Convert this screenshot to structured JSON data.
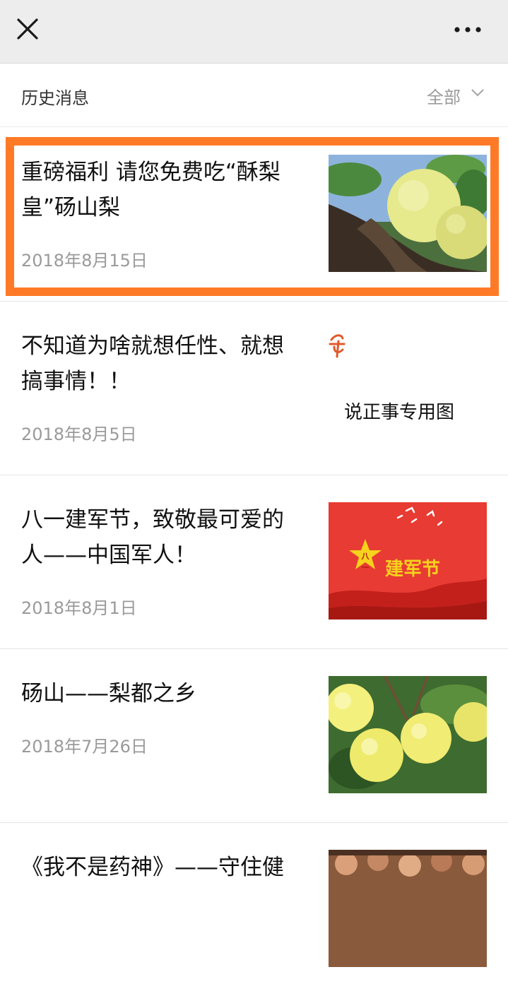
{
  "header": {
    "close_icon": "close-icon",
    "more_icon": "more-icon"
  },
  "subheader": {
    "title": "历史消息",
    "filter_label": "全部",
    "filter_icon": "chevron-down-icon"
  },
  "colors": {
    "highlight": "#ff7a26",
    "date_text": "#9a9a9a",
    "title_text": "#111111"
  },
  "articles": [
    {
      "title": "重磅福利 请您免费吃“酥梨皇”砀山梨",
      "date": "2018年8月15日",
      "thumbnail": "pear-on-tree-image",
      "selected": true
    },
    {
      "title": "不知道为啥就想任性、就想搞事情！！",
      "date": "2018年8月5日",
      "thumbnail_caption": "说正事专用图",
      "thumbnail": "text-graphic-image"
    },
    {
      "title": "八一建军节，致敬最可爱的人——中国军人！",
      "date": "2018年8月1日",
      "thumbnail_text": "建军节",
      "thumbnail_badge": "八一",
      "thumbnail": "army-day-poster-image"
    },
    {
      "title": "砀山——梨都之乡",
      "date": "2018年7月26日",
      "thumbnail": "pears-cluster-image"
    },
    {
      "title": "《我不是药神》——守住健",
      "thumbnail": "crowd-photo-image"
    }
  ]
}
